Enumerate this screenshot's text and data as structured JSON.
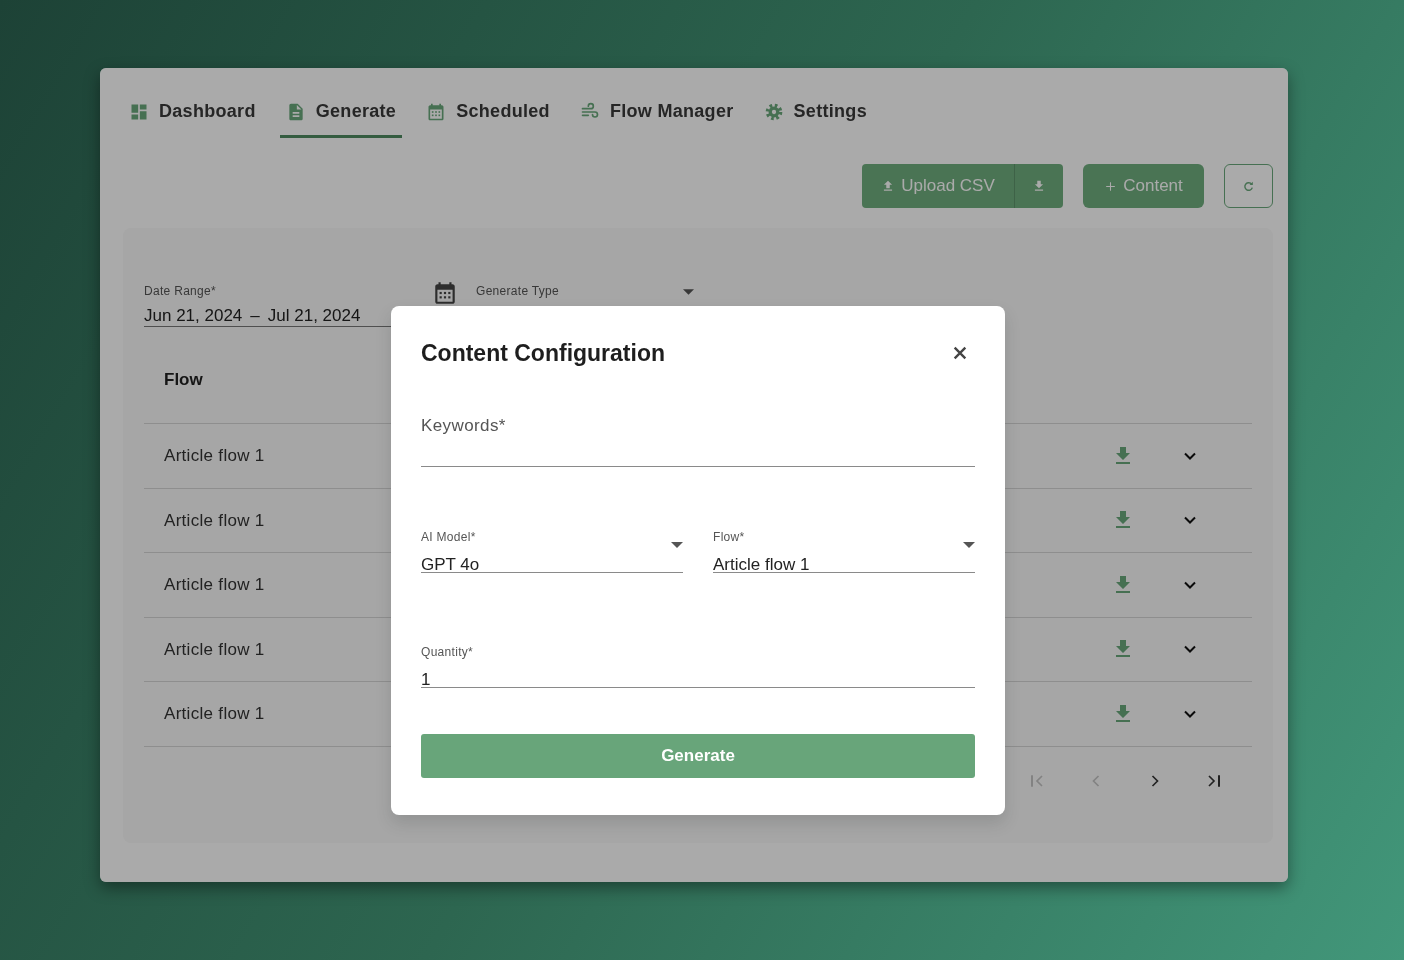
{
  "nav": {
    "tabs": [
      {
        "label": "Dashboard",
        "selected": false
      },
      {
        "label": "Generate",
        "selected": true
      },
      {
        "label": "Scheduled",
        "selected": false
      },
      {
        "label": "Flow Manager",
        "selected": false
      },
      {
        "label": "Settings",
        "selected": false
      }
    ]
  },
  "toolbar": {
    "upload_label": "Upload CSV",
    "add_label": "Content"
  },
  "filters": {
    "date_range": {
      "label": "Date Range*",
      "start": "Jun 21, 2024",
      "separator": "–",
      "end": "Jul 21, 2024"
    },
    "generate_type": {
      "label": "Generate Type"
    }
  },
  "table": {
    "columns": [
      "Flow"
    ],
    "rows": [
      {
        "flow": "Article flow 1"
      },
      {
        "flow": "Article flow 1"
      },
      {
        "flow": "Article flow 1"
      },
      {
        "flow": "Article flow 1"
      },
      {
        "flow": "Article flow 1"
      }
    ]
  },
  "pagination": [
    {
      "kind": "first",
      "disabled": true
    },
    {
      "kind": "prev",
      "disabled": true
    },
    {
      "kind": "next",
      "disabled": false
    },
    {
      "kind": "last",
      "disabled": false
    }
  ],
  "modal": {
    "title": "Content Configuration",
    "fields": [
      {
        "kind": "text",
        "label": "Keywords*"
      },
      {
        "kind": "select",
        "label": "AI Model*",
        "value": "GPT 4o"
      },
      {
        "kind": "select",
        "label": "Flow*",
        "value": "Article flow 1"
      },
      {
        "kind": "text",
        "label": "Quantity*",
        "value": "1"
      }
    ],
    "submit": "Generate"
  }
}
